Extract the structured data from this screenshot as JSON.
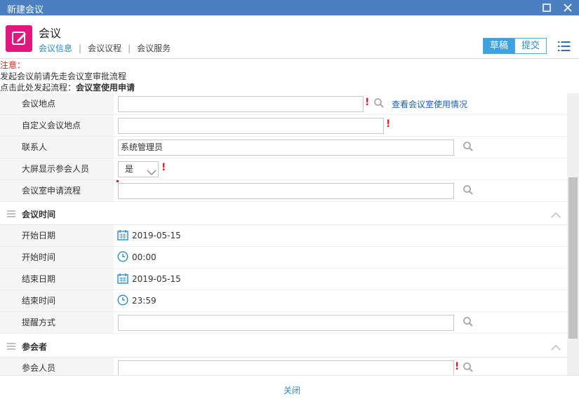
{
  "window": {
    "title": "新建会议"
  },
  "header": {
    "app_title": "会议",
    "tabs": [
      {
        "label": "会议信息",
        "active": true
      },
      {
        "label": "会议议程",
        "active": false
      },
      {
        "label": "会议服务",
        "active": false
      }
    ],
    "draft_label": "草稿",
    "submit_label": "提交"
  },
  "notice": {
    "heading": "注意：",
    "line1": "发起会议前请先走会议室审批流程",
    "line2_prefix": "点击此处发起流程：",
    "line2_link": "会议室使用申请"
  },
  "form": {
    "location_label": "会议地点",
    "location_value": "",
    "view_room_link": "查看会议室使用情况",
    "custom_location_label": "自定义会议地点",
    "custom_location_value": "",
    "contact_label": "联系人",
    "contact_value": "系统管理员",
    "big_screen_label": "大屏显示参会人员",
    "big_screen_value": "是",
    "room_flow_label": "会议室申请流程",
    "room_flow_value": ""
  },
  "time_section": {
    "title": "会议时间",
    "start_date_label": "开始日期",
    "start_date_value": "2019-05-15",
    "start_time_label": "开始时间",
    "start_time_value": "00:00",
    "end_date_label": "结束日期",
    "end_date_value": "2019-05-15",
    "end_time_label": "结束时间",
    "end_time_value": "23:59",
    "remind_label": "提醒方式",
    "remind_value": ""
  },
  "attendee_section": {
    "title": "参会者",
    "attendees_label": "参会人员",
    "attendees_value": ""
  },
  "footer": {
    "close_label": "关闭"
  },
  "colors": {
    "titlebar": "#4a7fc1",
    "accent": "#2b8bd0",
    "app_icon": "#e0187e",
    "required": "#e02020"
  },
  "icons": [
    "maximize-icon",
    "close-icon",
    "edit-icon",
    "menu-icon",
    "search-icon",
    "calendar-icon",
    "clock-icon",
    "chevron-up-icon",
    "chevron-down-icon",
    "drag-handle-icon"
  ]
}
